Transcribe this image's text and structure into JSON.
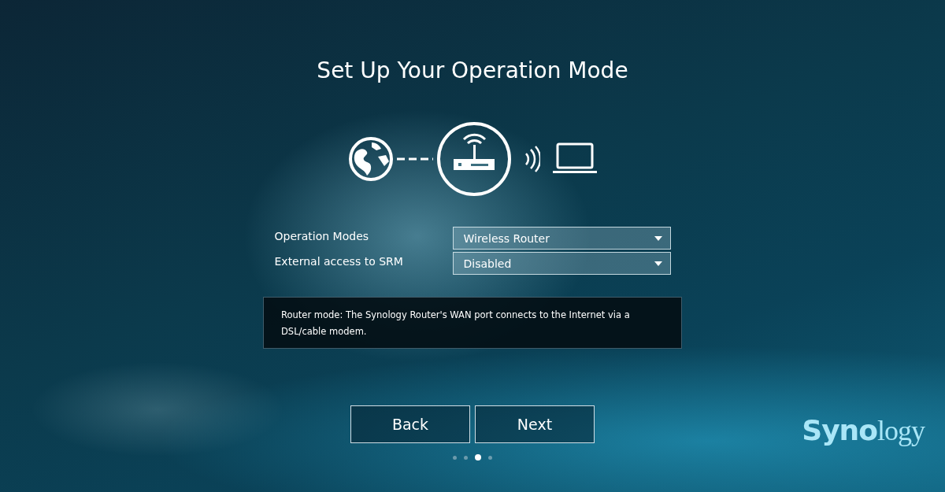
{
  "title": "Set Up Your Operation Mode",
  "fields": [
    {
      "label": "Operation Modes",
      "value": "Wireless Router"
    },
    {
      "label": "External access to SRM",
      "value": "Disabled"
    }
  ],
  "description": "Router mode: The Synology Router's WAN port connects to the Internet via a DSL/cable modem.",
  "buttons": [
    "Back",
    "Next"
  ],
  "steps": [
    {
      "selected": false
    },
    {
      "selected": false
    },
    {
      "selected": true
    },
    {
      "selected": false
    }
  ],
  "logo": "**Syno**logy"
}
